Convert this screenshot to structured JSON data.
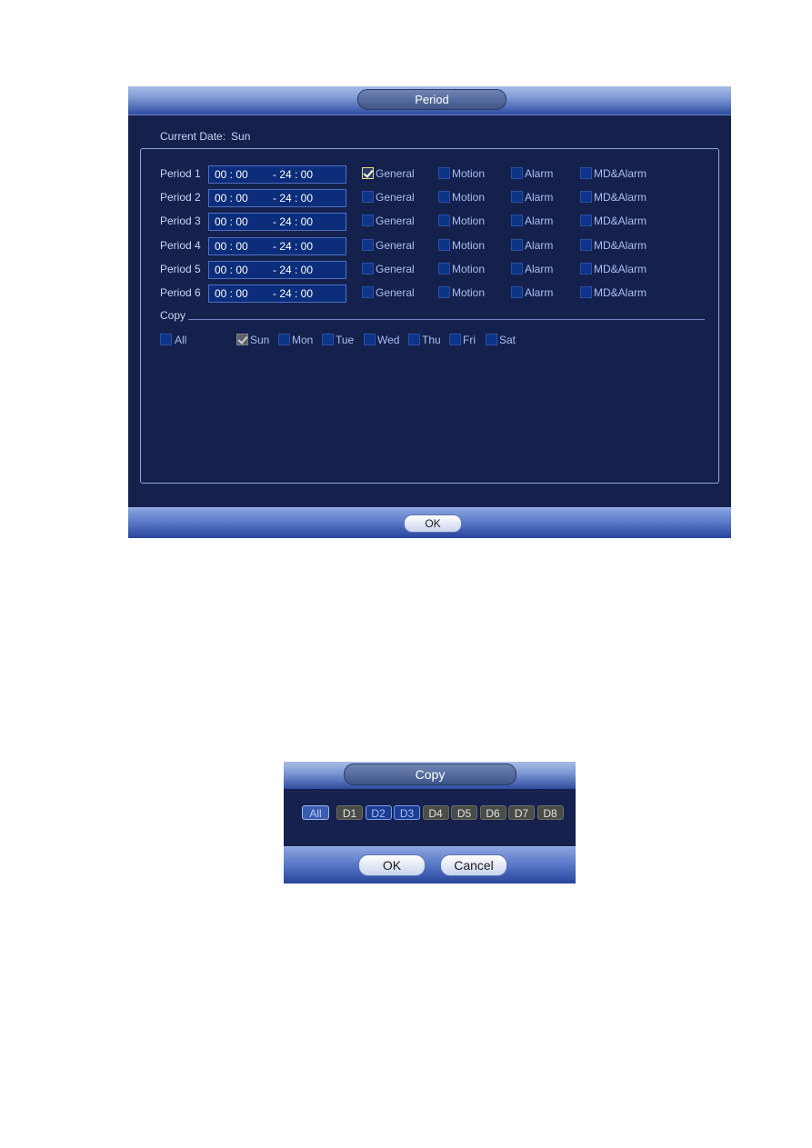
{
  "period_dialog": {
    "title": "Period",
    "current_date_label": "Current Date:",
    "current_date_value": "Sun",
    "periods": [
      {
        "label": "Period 1",
        "start": "00 : 00",
        "end": "- 24 : 00",
        "general": true,
        "motion": false,
        "alarm": false,
        "md_alarm": false
      },
      {
        "label": "Period 2",
        "start": "00 : 00",
        "end": "- 24 : 00",
        "general": false,
        "motion": false,
        "alarm": false,
        "md_alarm": false
      },
      {
        "label": "Period 3",
        "start": "00 : 00",
        "end": "- 24 : 00",
        "general": false,
        "motion": false,
        "alarm": false,
        "md_alarm": false
      },
      {
        "label": "Period 4",
        "start": "00 : 00",
        "end": "- 24 : 00",
        "general": false,
        "motion": false,
        "alarm": false,
        "md_alarm": false
      },
      {
        "label": "Period 5",
        "start": "00 : 00",
        "end": "- 24 : 00",
        "general": false,
        "motion": false,
        "alarm": false,
        "md_alarm": false
      },
      {
        "label": "Period 6",
        "start": "00 : 00",
        "end": "- 24 : 00",
        "general": false,
        "motion": false,
        "alarm": false,
        "md_alarm": false
      }
    ],
    "type_labels": {
      "general": "General",
      "motion": "Motion",
      "alarm": "Alarm",
      "md_alarm": "MD&Alarm"
    },
    "copy_label": "Copy",
    "copy_all_label": "All",
    "copy_all_checked": false,
    "days": [
      {
        "label": "Sun",
        "checked": true
      },
      {
        "label": "Mon",
        "checked": false
      },
      {
        "label": "Tue",
        "checked": false
      },
      {
        "label": "Wed",
        "checked": false
      },
      {
        "label": "Thu",
        "checked": false
      },
      {
        "label": "Fri",
        "checked": false
      },
      {
        "label": "Sat",
        "checked": false
      }
    ],
    "ok_label": "OK"
  },
  "copy_dialog": {
    "title": "Copy",
    "all_label": "All",
    "channels": [
      {
        "label": "D1",
        "selected": false
      },
      {
        "label": "D2",
        "selected": true
      },
      {
        "label": "D3",
        "selected": true
      },
      {
        "label": "D4",
        "selected": false
      },
      {
        "label": "D5",
        "selected": false
      },
      {
        "label": "D6",
        "selected": false
      },
      {
        "label": "D7",
        "selected": false
      },
      {
        "label": "D8",
        "selected": false
      }
    ],
    "ok_label": "OK",
    "cancel_label": "Cancel"
  }
}
